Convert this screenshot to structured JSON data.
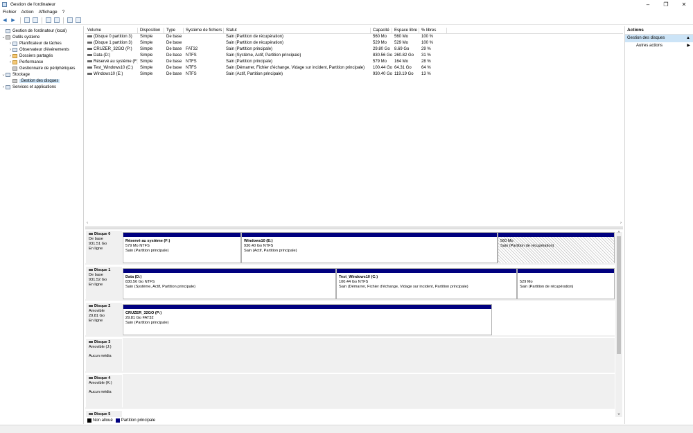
{
  "window": {
    "title": "Gestion de l'ordinateur"
  },
  "menu": [
    "Fichier",
    "Action",
    "Affichage",
    "?"
  ],
  "tree": [
    {
      "label": "Gestion de l'ordinateur (local)",
      "level": 0,
      "expander": "",
      "icon": "computer-icon"
    },
    {
      "label": "Outils système",
      "level": 1,
      "expander": "⌄",
      "icon": "tools-icon"
    },
    {
      "label": "Planificateur de tâches",
      "level": 2,
      "expander": "›",
      "icon": "clock-icon"
    },
    {
      "label": "Observateur d'événements",
      "level": 2,
      "expander": "›",
      "icon": "event-viewer-icon"
    },
    {
      "label": "Dossiers partagés",
      "level": 2,
      "expander": "›",
      "icon": "shared-folder-icon"
    },
    {
      "label": "Performance",
      "level": 2,
      "expander": "›",
      "icon": "performance-icon"
    },
    {
      "label": "Gestionnaire de périphériques",
      "level": 2,
      "expander": "",
      "icon": "device-manager-icon"
    },
    {
      "label": "Stockage",
      "level": 1,
      "expander": "⌄",
      "icon": "storage-icon"
    },
    {
      "label": "Gestion des disques",
      "level": 2,
      "expander": "",
      "icon": "disk-management-icon",
      "selected": true
    },
    {
      "label": "Services et applications",
      "level": 1,
      "expander": "›",
      "icon": "services-icon"
    }
  ],
  "columns": [
    "Volume",
    "Disposition",
    "Type",
    "Système de fichiers",
    "Statut",
    "Capacité",
    "Espace libre",
    "% libres"
  ],
  "volumes": [
    [
      "(Disque 0 partition 3)",
      "Simple",
      "De base",
      "",
      "Sain (Partition de récupération)",
      "560 Mo",
      "560 Mo",
      "100 %"
    ],
    [
      "(Disque 1 partition 3)",
      "Simple",
      "De base",
      "",
      "Sain (Partition de récupération)",
      "529 Mo",
      "529 Mo",
      "100 %"
    ],
    [
      "CRUZER_32GO (P:)",
      "Simple",
      "De base",
      "FAT32",
      "Sain (Partition principale)",
      "29.80 Go",
      "8.69 Go",
      "29 %"
    ],
    [
      "Data (D:)",
      "Simple",
      "De base",
      "NTFS",
      "Sain (Système, Actif, Partition principale)",
      "830.56 Go",
      "260.82 Go",
      "31 %"
    ],
    [
      "Réservé au système (F:)",
      "Simple",
      "De base",
      "NTFS",
      "Sain (Partition principale)",
      "579 Mo",
      "164 Mo",
      "28 %"
    ],
    [
      "Test_Windows10 (C:)",
      "Simple",
      "De base",
      "NTFS",
      "Sain (Démarrer, Fichier d'échange, Vidage sur incident, Partition principale)",
      "100.44 Go",
      "64.31 Go",
      "64 %"
    ],
    [
      "Windows10 (E:)",
      "Simple",
      "De base",
      "NTFS",
      "Sain (Actif, Partition principale)",
      "930.40 Go",
      "119.19 Go",
      "13 %"
    ]
  ],
  "disks": [
    {
      "name": "Disque 0",
      "kind": "De base",
      "size": "931.51 Go",
      "state": "En ligne",
      "partitions": [
        {
          "name": "Réservé au système  (F:)",
          "size_fs": "579 Mo NTFS",
          "status": "Sain (Partition principale)"
        },
        {
          "name": "Windows10  (E:)",
          "size_fs": "930.40 Go NTFS",
          "status": "Sain (Actif, Partition principale)"
        },
        {
          "name": "",
          "size_fs": "560 Mo",
          "status": "Sain (Partition de récupération)"
        }
      ]
    },
    {
      "name": "Disque 1",
      "kind": "De base",
      "size": "931.52 Go",
      "state": "En ligne",
      "partitions": [
        {
          "name": "Data  (D:)",
          "size_fs": "830.56 Go NTFS",
          "status": "Sain (Système, Actif, Partition principale)"
        },
        {
          "name": "Test_Windows10  (C:)",
          "size_fs": "100.44 Go NTFS",
          "status": "Sain (Démarrer, Fichier d'échange, Vidage sur incident, Partition principale)"
        },
        {
          "name": "",
          "size_fs": "529 Mo",
          "status": "Sain (Partition de récupération)"
        }
      ]
    },
    {
      "name": "Disque 2",
      "kind": "Amovible",
      "size": "29.81 Go",
      "state": "En ligne",
      "partitions": [
        {
          "name": "CRUZER_32GO  (P:)",
          "size_fs": "29.81 Go FAT32",
          "status": "Sain (Partition principale)"
        }
      ]
    },
    {
      "name": "Disque 3",
      "kind": "Amovible (J:)",
      "size": "",
      "state": "Aucun média",
      "partitions": []
    },
    {
      "name": "Disque 4",
      "kind": "Amovible (K:)",
      "size": "",
      "state": "Aucun média",
      "partitions": []
    },
    {
      "name": "Disque 5",
      "kind": "",
      "size": "",
      "state": "",
      "partitions": []
    }
  ],
  "legend": {
    "unallocated": "Non alloué",
    "primary": "Partition principale"
  },
  "actions": {
    "header": "Actions",
    "section": "Gestion des disques",
    "more": "Autres actions"
  },
  "colors": {
    "primary_partition": "#00007f",
    "unallocated": "#000000",
    "selection": "#cce4f7"
  }
}
